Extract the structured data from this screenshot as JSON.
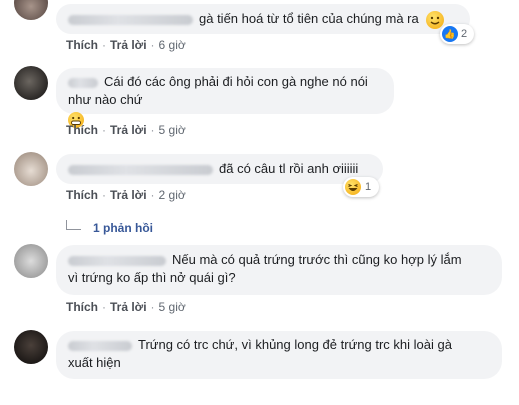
{
  "comments": [
    {
      "text": "gà tiến hoá từ tổ tiên của chúng mà ra",
      "actions": {
        "like": "Thích",
        "reply": "Trả lời",
        "time": "6 giờ"
      },
      "reaction_count": "2"
    },
    {
      "text": "Cái đó các ông phải đi hỏi con gà nghe nó nói như nào chứ",
      "actions": {
        "like": "Thích",
        "reply": "Trả lời",
        "time": "5 giờ"
      }
    },
    {
      "text": "đã có câu tl rồi anh ơiiiiii",
      "actions": {
        "like": "Thích",
        "reply": "Trả lời",
        "time": "2 giờ"
      },
      "reaction_count": "1",
      "replies_label": "1 phản hồi"
    },
    {
      "text_line1": "Nếu mà có quả trứng trước thì cũng ko hợp lý lắm",
      "text_line2": "vì trứng ko ấp thì nở quái gì?",
      "actions": {
        "like": "Thích",
        "reply": "Trả lời",
        "time": "5 giờ"
      }
    },
    {
      "text_line1": "Trứng có trc chứ, vì khủng long đẻ trứng trc khi loài gà",
      "text_line2": "xuất hiện"
    }
  ],
  "colors": {
    "bubble": "#f2f3f5",
    "link": "#385898",
    "like_blue": "#1877f2",
    "emoji_yellow": "#f7b928"
  }
}
